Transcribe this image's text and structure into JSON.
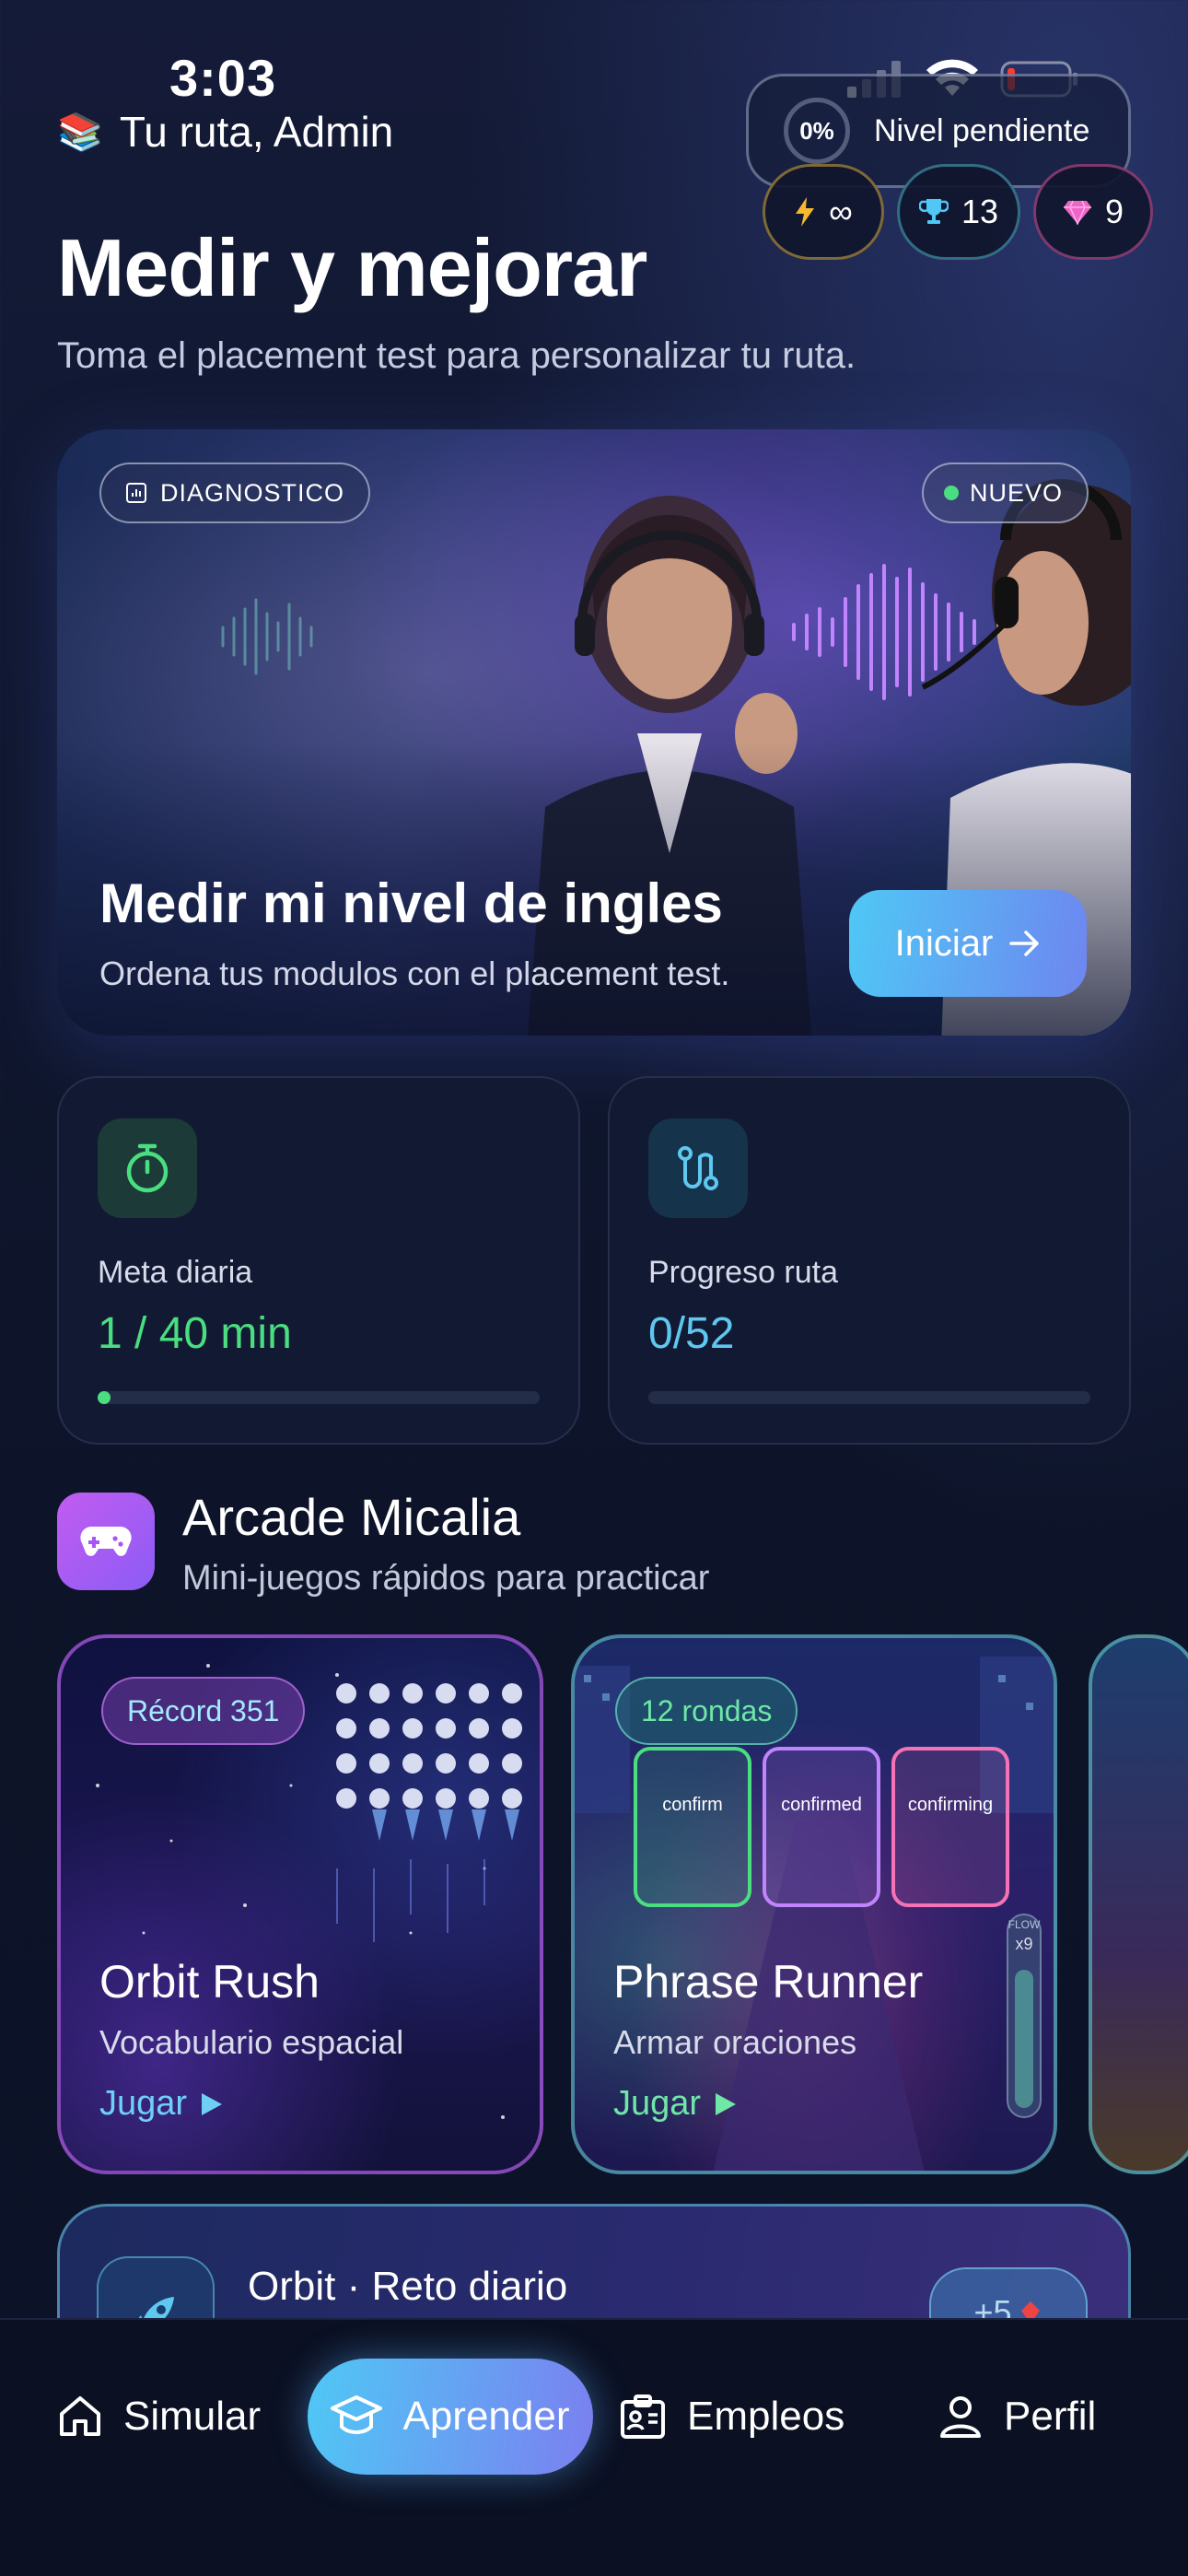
{
  "status_bar": {
    "time": "3:03"
  },
  "header": {
    "greeting": "Tu ruta, Admin",
    "greeting_icon": "books-icon",
    "level": {
      "percent": "0%",
      "label": "Nivel pendiente",
      "progress": 0
    },
    "chips": {
      "streak": "∞",
      "trophies": "13",
      "gems": "9"
    }
  },
  "page": {
    "title": "Medir y mejorar",
    "subtitle": "Toma el placement test para personalizar tu ruta."
  },
  "hero": {
    "tag": "DIAGNOSTICO",
    "badge": "NUEVO",
    "title": "Medir mi nivel de ingles",
    "subtitle": "Ordena tus modulos con el placement test.",
    "button": "Iniciar"
  },
  "stats": {
    "daily_goal": {
      "label": "Meta diaria",
      "value": "1 / 40 min",
      "progress": 0.025,
      "color": "#4ade80"
    },
    "route_progress": {
      "label": "Progreso ruta",
      "value": "0/52",
      "progress": 0,
      "color": "#5ec8f0"
    }
  },
  "arcade": {
    "title": "Arcade Micalia",
    "subtitle": "Mini-juegos rápidos para practicar",
    "games": [
      {
        "badge": "Récord 351",
        "title": "Orbit Rush",
        "subtitle": "Vocabulario espacial",
        "play": "Jugar"
      },
      {
        "badge": "12 rondas",
        "title": "Phrase Runner",
        "subtitle": "Armar oraciones",
        "play": "Jugar",
        "lanes": [
          "confirm",
          "confirmed",
          "confirming"
        ],
        "flow_label": "FLOW",
        "flow_multiplier": "x9"
      }
    ]
  },
  "daily_challenge": {
    "title": "Orbit · Reto diario",
    "bonus": "+5"
  },
  "nav": {
    "items": [
      {
        "label": "Simular",
        "icon": "home-icon"
      },
      {
        "label": "Aprender",
        "icon": "graduation-cap-icon",
        "active": true
      },
      {
        "label": "Empleos",
        "icon": "briefcase-badge-icon"
      },
      {
        "label": "Perfil",
        "icon": "user-icon"
      }
    ]
  },
  "colors": {
    "accent_green": "#4ade80",
    "accent_blue": "#4fc8f5",
    "accent_purple": "#8b5cf6",
    "background": "#10172f"
  }
}
